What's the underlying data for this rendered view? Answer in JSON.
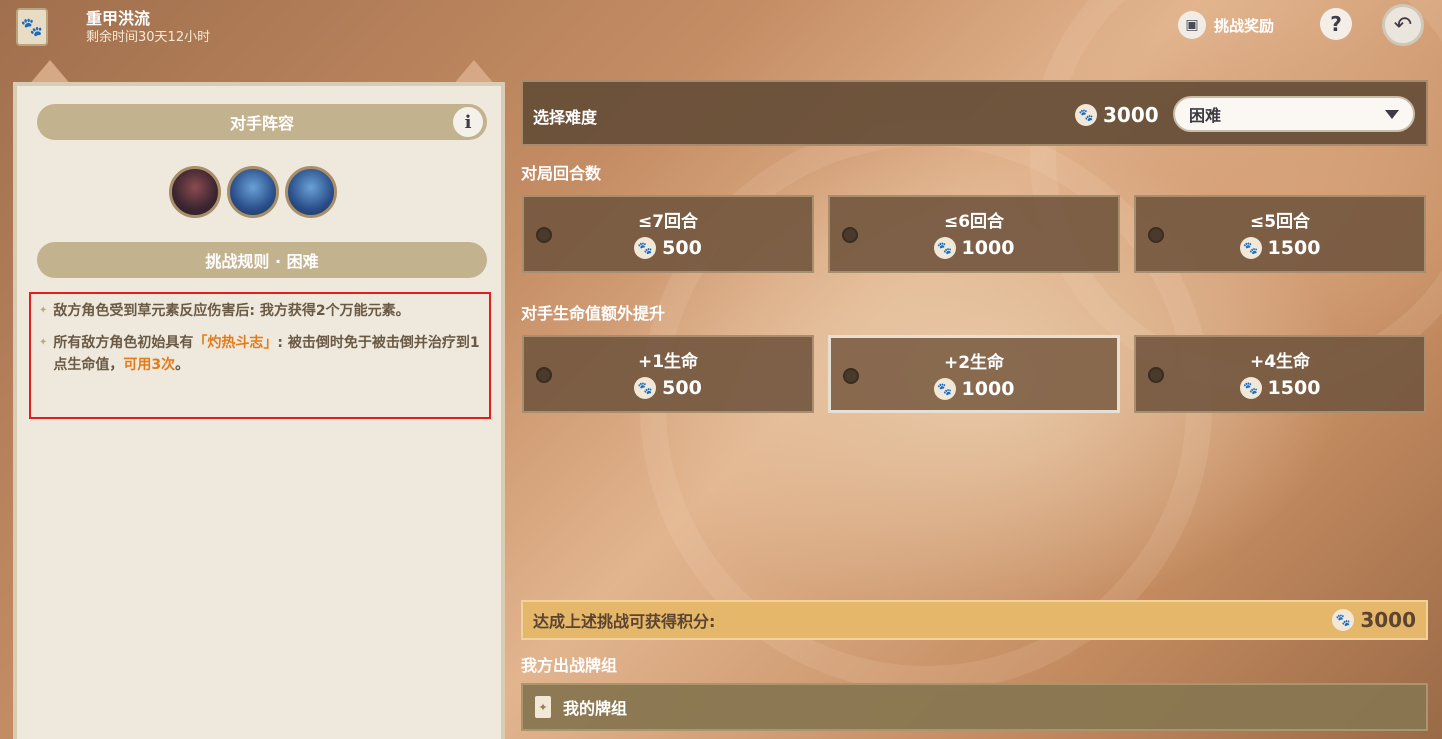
{
  "header": {
    "title": "重甲洪流",
    "subtitle": "剩余时间30天12小时",
    "reward_label": "挑战奖励",
    "help_symbol": "?",
    "back_symbol": "↶"
  },
  "left_panel": {
    "lineup_title": "对手阵容",
    "info_symbol": "i",
    "rules_title": "挑战规则 · 困难",
    "rules": [
      {
        "star": "✦",
        "part1": "敌方角色受到草元素反应伤害后: 我方获得2个万能元素。",
        "highlight1": "",
        "part2": "",
        "highlight2": "",
        "part3": ""
      },
      {
        "star": "✦",
        "part1": "所有敌方角色初始具有",
        "highlight1": "「灼热斗志」",
        "part2": ": 被击倒时免于被击倒并治疗到1点生命值，",
        "highlight2": "可用3次",
        "part3": "。"
      }
    ]
  },
  "difficulty": {
    "label": "选择难度",
    "cost": "3000",
    "selected": "困难"
  },
  "rounds": {
    "label": "对局回合数",
    "options": [
      {
        "title": "≤7回合",
        "cost": "500"
      },
      {
        "title": "≤6回合",
        "cost": "1000"
      },
      {
        "title": "≤5回合",
        "cost": "1500"
      }
    ]
  },
  "hp_boost": {
    "label": "对手生命值额外提升",
    "options": [
      {
        "title": "+1生命",
        "cost": "500"
      },
      {
        "title": "+2生命",
        "cost": "1000"
      },
      {
        "title": "+4生命",
        "cost": "1500"
      }
    ]
  },
  "score": {
    "label": "达成上述挑战可获得积分:",
    "value": "3000"
  },
  "deck": {
    "section_label": "我方出战牌组",
    "deck_name": "我的牌组"
  },
  "icons": {
    "paw": "🐾",
    "deck": "✦"
  }
}
